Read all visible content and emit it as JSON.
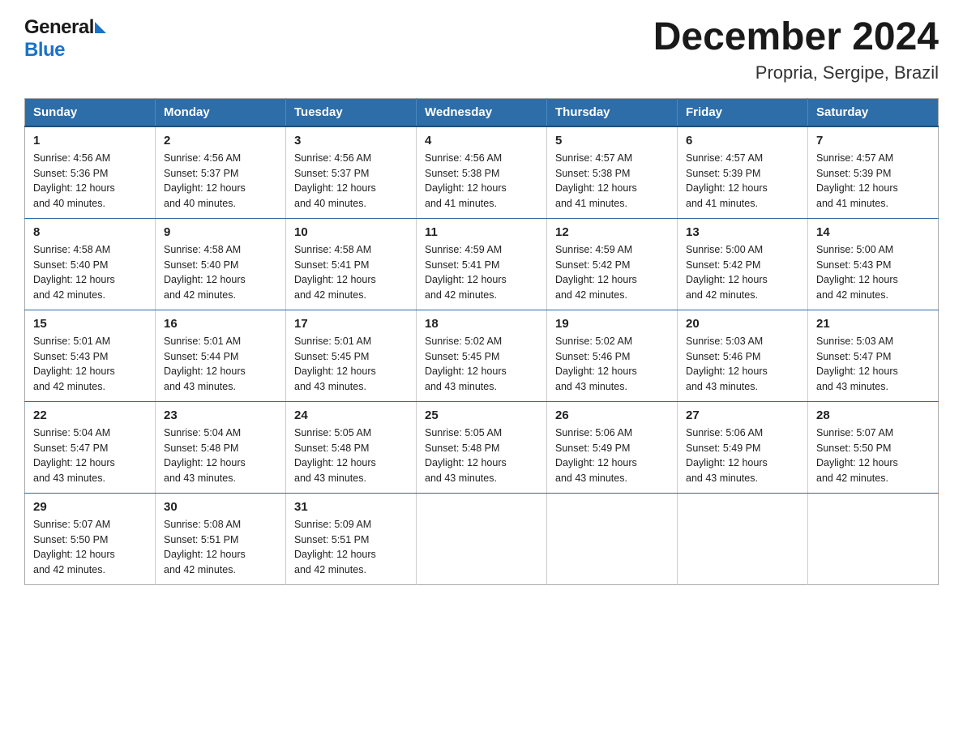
{
  "header": {
    "logo_general": "General",
    "logo_blue": "Blue",
    "title": "December 2024",
    "subtitle": "Propria, Sergipe, Brazil"
  },
  "days_of_week": [
    "Sunday",
    "Monday",
    "Tuesday",
    "Wednesday",
    "Thursday",
    "Friday",
    "Saturday"
  ],
  "weeks": [
    [
      {
        "day": "1",
        "sunrise": "Sunrise: 4:56 AM",
        "sunset": "Sunset: 5:36 PM",
        "daylight": "Daylight: 12 hours",
        "daylight2": "and 40 minutes."
      },
      {
        "day": "2",
        "sunrise": "Sunrise: 4:56 AM",
        "sunset": "Sunset: 5:37 PM",
        "daylight": "Daylight: 12 hours",
        "daylight2": "and 40 minutes."
      },
      {
        "day": "3",
        "sunrise": "Sunrise: 4:56 AM",
        "sunset": "Sunset: 5:37 PM",
        "daylight": "Daylight: 12 hours",
        "daylight2": "and 40 minutes."
      },
      {
        "day": "4",
        "sunrise": "Sunrise: 4:56 AM",
        "sunset": "Sunset: 5:38 PM",
        "daylight": "Daylight: 12 hours",
        "daylight2": "and 41 minutes."
      },
      {
        "day": "5",
        "sunrise": "Sunrise: 4:57 AM",
        "sunset": "Sunset: 5:38 PM",
        "daylight": "Daylight: 12 hours",
        "daylight2": "and 41 minutes."
      },
      {
        "day": "6",
        "sunrise": "Sunrise: 4:57 AM",
        "sunset": "Sunset: 5:39 PM",
        "daylight": "Daylight: 12 hours",
        "daylight2": "and 41 minutes."
      },
      {
        "day": "7",
        "sunrise": "Sunrise: 4:57 AM",
        "sunset": "Sunset: 5:39 PM",
        "daylight": "Daylight: 12 hours",
        "daylight2": "and 41 minutes."
      }
    ],
    [
      {
        "day": "8",
        "sunrise": "Sunrise: 4:58 AM",
        "sunset": "Sunset: 5:40 PM",
        "daylight": "Daylight: 12 hours",
        "daylight2": "and 42 minutes."
      },
      {
        "day": "9",
        "sunrise": "Sunrise: 4:58 AM",
        "sunset": "Sunset: 5:40 PM",
        "daylight": "Daylight: 12 hours",
        "daylight2": "and 42 minutes."
      },
      {
        "day": "10",
        "sunrise": "Sunrise: 4:58 AM",
        "sunset": "Sunset: 5:41 PM",
        "daylight": "Daylight: 12 hours",
        "daylight2": "and 42 minutes."
      },
      {
        "day": "11",
        "sunrise": "Sunrise: 4:59 AM",
        "sunset": "Sunset: 5:41 PM",
        "daylight": "Daylight: 12 hours",
        "daylight2": "and 42 minutes."
      },
      {
        "day": "12",
        "sunrise": "Sunrise: 4:59 AM",
        "sunset": "Sunset: 5:42 PM",
        "daylight": "Daylight: 12 hours",
        "daylight2": "and 42 minutes."
      },
      {
        "day": "13",
        "sunrise": "Sunrise: 5:00 AM",
        "sunset": "Sunset: 5:42 PM",
        "daylight": "Daylight: 12 hours",
        "daylight2": "and 42 minutes."
      },
      {
        "day": "14",
        "sunrise": "Sunrise: 5:00 AM",
        "sunset": "Sunset: 5:43 PM",
        "daylight": "Daylight: 12 hours",
        "daylight2": "and 42 minutes."
      }
    ],
    [
      {
        "day": "15",
        "sunrise": "Sunrise: 5:01 AM",
        "sunset": "Sunset: 5:43 PM",
        "daylight": "Daylight: 12 hours",
        "daylight2": "and 42 minutes."
      },
      {
        "day": "16",
        "sunrise": "Sunrise: 5:01 AM",
        "sunset": "Sunset: 5:44 PM",
        "daylight": "Daylight: 12 hours",
        "daylight2": "and 43 minutes."
      },
      {
        "day": "17",
        "sunrise": "Sunrise: 5:01 AM",
        "sunset": "Sunset: 5:45 PM",
        "daylight": "Daylight: 12 hours",
        "daylight2": "and 43 minutes."
      },
      {
        "day": "18",
        "sunrise": "Sunrise: 5:02 AM",
        "sunset": "Sunset: 5:45 PM",
        "daylight": "Daylight: 12 hours",
        "daylight2": "and 43 minutes."
      },
      {
        "day": "19",
        "sunrise": "Sunrise: 5:02 AM",
        "sunset": "Sunset: 5:46 PM",
        "daylight": "Daylight: 12 hours",
        "daylight2": "and 43 minutes."
      },
      {
        "day": "20",
        "sunrise": "Sunrise: 5:03 AM",
        "sunset": "Sunset: 5:46 PM",
        "daylight": "Daylight: 12 hours",
        "daylight2": "and 43 minutes."
      },
      {
        "day": "21",
        "sunrise": "Sunrise: 5:03 AM",
        "sunset": "Sunset: 5:47 PM",
        "daylight": "Daylight: 12 hours",
        "daylight2": "and 43 minutes."
      }
    ],
    [
      {
        "day": "22",
        "sunrise": "Sunrise: 5:04 AM",
        "sunset": "Sunset: 5:47 PM",
        "daylight": "Daylight: 12 hours",
        "daylight2": "and 43 minutes."
      },
      {
        "day": "23",
        "sunrise": "Sunrise: 5:04 AM",
        "sunset": "Sunset: 5:48 PM",
        "daylight": "Daylight: 12 hours",
        "daylight2": "and 43 minutes."
      },
      {
        "day": "24",
        "sunrise": "Sunrise: 5:05 AM",
        "sunset": "Sunset: 5:48 PM",
        "daylight": "Daylight: 12 hours",
        "daylight2": "and 43 minutes."
      },
      {
        "day": "25",
        "sunrise": "Sunrise: 5:05 AM",
        "sunset": "Sunset: 5:48 PM",
        "daylight": "Daylight: 12 hours",
        "daylight2": "and 43 minutes."
      },
      {
        "day": "26",
        "sunrise": "Sunrise: 5:06 AM",
        "sunset": "Sunset: 5:49 PM",
        "daylight": "Daylight: 12 hours",
        "daylight2": "and 43 minutes."
      },
      {
        "day": "27",
        "sunrise": "Sunrise: 5:06 AM",
        "sunset": "Sunset: 5:49 PM",
        "daylight": "Daylight: 12 hours",
        "daylight2": "and 43 minutes."
      },
      {
        "day": "28",
        "sunrise": "Sunrise: 5:07 AM",
        "sunset": "Sunset: 5:50 PM",
        "daylight": "Daylight: 12 hours",
        "daylight2": "and 42 minutes."
      }
    ],
    [
      {
        "day": "29",
        "sunrise": "Sunrise: 5:07 AM",
        "sunset": "Sunset: 5:50 PM",
        "daylight": "Daylight: 12 hours",
        "daylight2": "and 42 minutes."
      },
      {
        "day": "30",
        "sunrise": "Sunrise: 5:08 AM",
        "sunset": "Sunset: 5:51 PM",
        "daylight": "Daylight: 12 hours",
        "daylight2": "and 42 minutes."
      },
      {
        "day": "31",
        "sunrise": "Sunrise: 5:09 AM",
        "sunset": "Sunset: 5:51 PM",
        "daylight": "Daylight: 12 hours",
        "daylight2": "and 42 minutes."
      },
      null,
      null,
      null,
      null
    ]
  ]
}
